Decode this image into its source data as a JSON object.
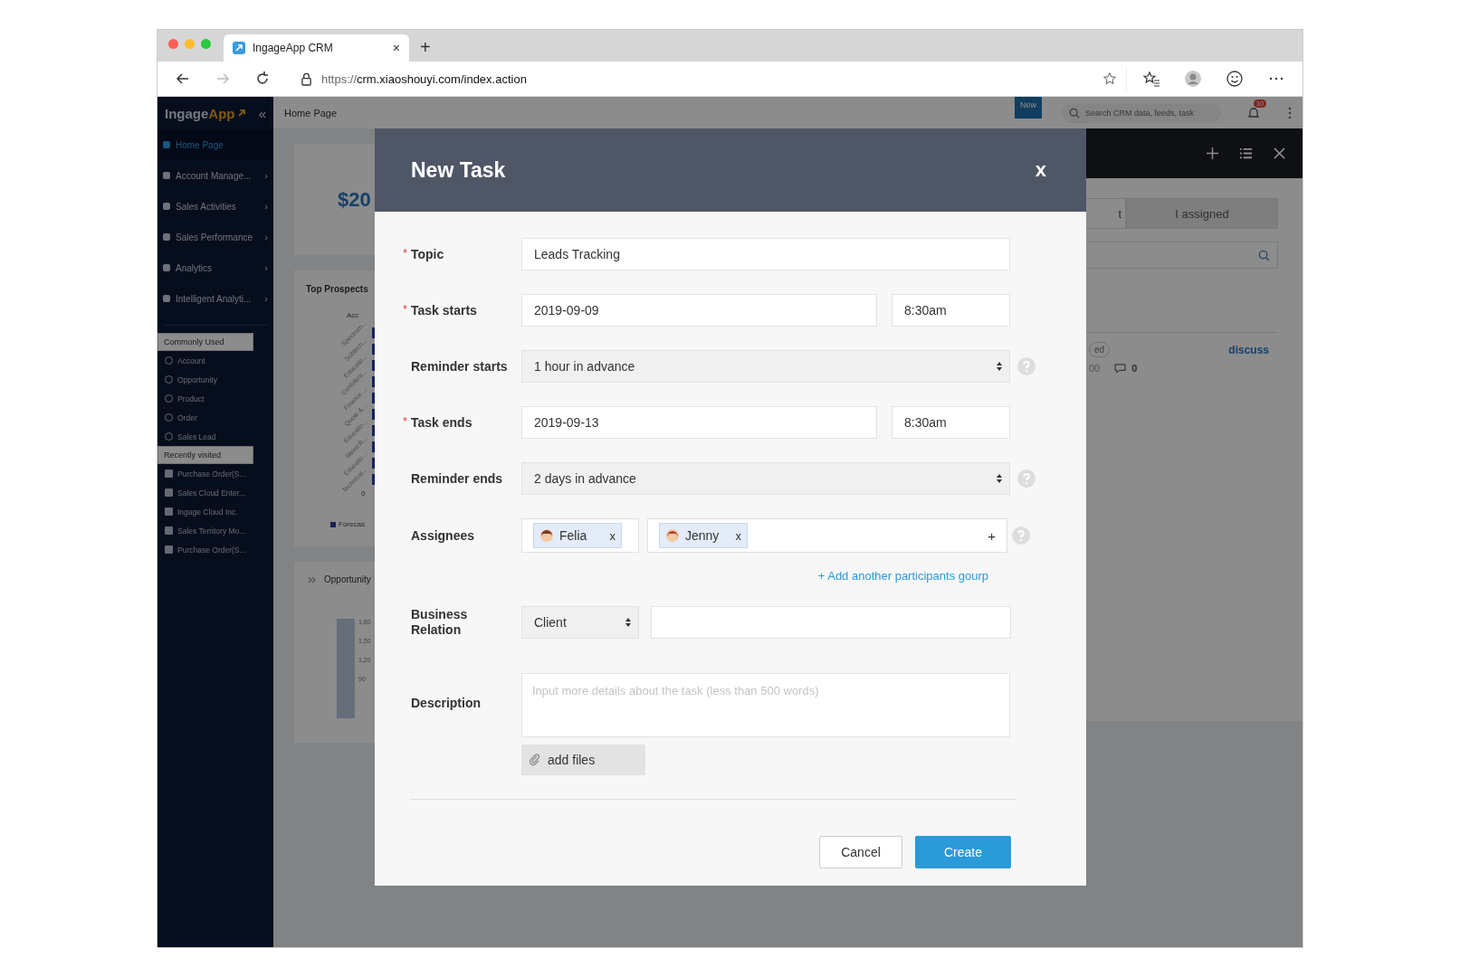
{
  "browser": {
    "tab_title": "IngageApp CRM",
    "tab_close": "×",
    "new_tab": "+",
    "url_scheme": "https://",
    "url_rest": "crm.xiaoshouyi.com/index.action"
  },
  "sidebar": {
    "logo_main": "Ingage",
    "logo_accent": "App",
    "collapse": "«",
    "nav": [
      {
        "label": "Home Page",
        "selected": true
      },
      {
        "label": "Account Manage...",
        "selected": false,
        "arrow": "›"
      },
      {
        "label": "Sales Activities",
        "selected": false,
        "arrow": "›"
      },
      {
        "label": "Sales Performance",
        "selected": false,
        "arrow": "›"
      },
      {
        "label": "Analytics",
        "selected": false,
        "arrow": "›"
      },
      {
        "label": "Intelligent Analyti...",
        "selected": false,
        "arrow": "›"
      }
    ],
    "sections": [
      {
        "title": "Commonly Used",
        "kind": "star",
        "items": [
          "Account",
          "Opportunity",
          "Product",
          "Order",
          "Sales Lead"
        ]
      },
      {
        "title": "Recently visited",
        "kind": "doc",
        "items": [
          "Purchase Order(S...",
          "Sales Cloud Enter...",
          "Ingage Cloud Inc.",
          "Sales Territory Mo...",
          "Purchase Order(S..."
        ]
      }
    ]
  },
  "topbar": {
    "breadcrumb": "Home Page",
    "new_badge": "New",
    "search_placeholder": "Search CRM data, feeds, task",
    "notifications": "10"
  },
  "dashboard": {
    "amount": "$20",
    "prospects_title": "Top Prospects",
    "axis_title": "Acc",
    "prospect_labels": [
      "Spectrum...",
      "Sobtech...",
      "Educatio...",
      "Confident...",
      "Finance ...",
      "Quote &...",
      "Educatio...",
      "Weird R...",
      "Educatio...",
      "Technical..."
    ],
    "axis_zero": "0",
    "legend": "Forecas",
    "opportunity_title": "Opportunity",
    "opportunity_ticks": [
      "1,80",
      "1,50",
      "1,20",
      "90"
    ]
  },
  "task_panel": {
    "tabs": [
      {
        "label": "t",
        "selected": true
      },
      {
        "label": "I assigned",
        "selected": false
      }
    ],
    "status_tag": "ed",
    "discuss": "discuss",
    "likes": "00",
    "comments": "0"
  },
  "modal": {
    "title": "New Task",
    "close": "x",
    "rows": [
      {
        "kind": "text",
        "label": "Topic",
        "required": "*",
        "value": "Leads Tracking"
      },
      {
        "kind": "datetime",
        "label": "Task starts",
        "required": "*",
        "value": "2019-09-09",
        "time": "8:30am"
      },
      {
        "kind": "select",
        "label": "Reminder starts",
        "value": "1 hour in advance",
        "help": true
      },
      {
        "kind": "datetime",
        "label": "Task ends",
        "required": "*",
        "value": "2019-09-13",
        "time": "8:30am"
      },
      {
        "kind": "select",
        "label": "Reminder ends",
        "value": "2 days in advance",
        "help": true
      },
      {
        "kind": "assignees",
        "label": "Assignees",
        "help": true,
        "add": "+",
        "groups": [
          [
            {
              "name": "Felia",
              "remove": "x"
            }
          ],
          [
            {
              "name": "Jenny",
              "remove": "x"
            }
          ]
        ],
        "link": "+ Add another participants gourp"
      },
      {
        "kind": "relation",
        "label": "Business Relation",
        "value": "Client"
      },
      {
        "kind": "textarea",
        "label": "Description",
        "placeholder": "Input more details about the task (less than 500 words)",
        "attach": "add files"
      }
    ],
    "buttons": [
      {
        "label": "Cancel",
        "kind": "secondary"
      },
      {
        "label": "Create",
        "kind": "primary"
      }
    ]
  }
}
